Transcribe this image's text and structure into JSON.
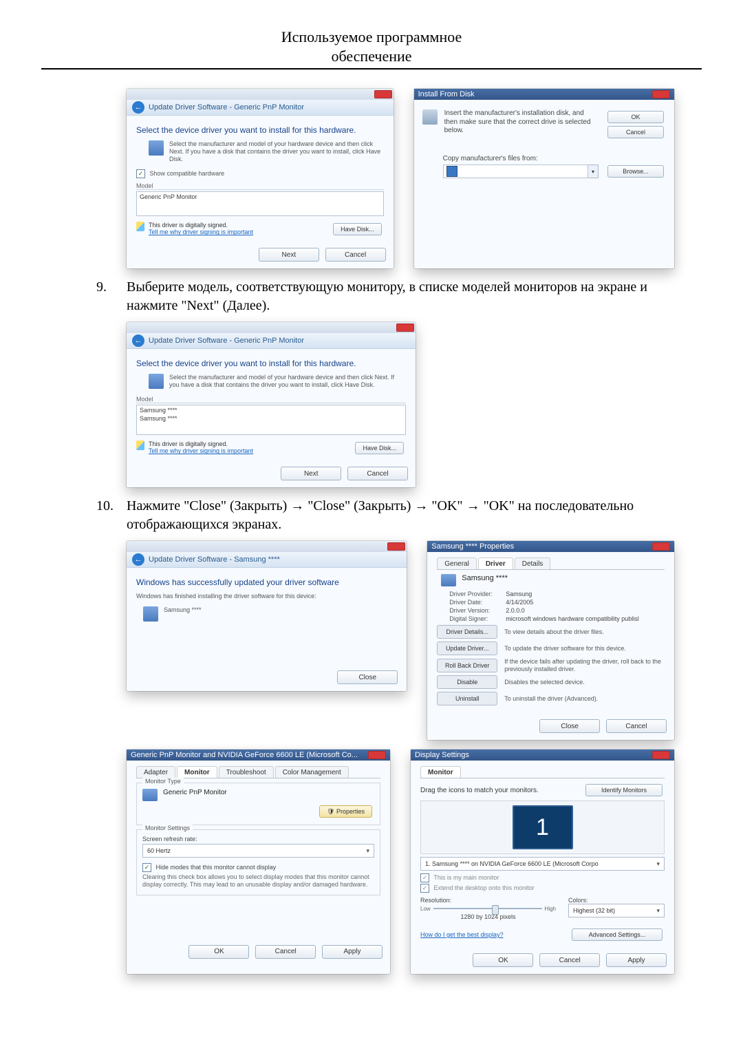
{
  "header": {
    "line1": "Используемое программное",
    "line2": "обеспечение"
  },
  "arrow": "→",
  "step9": {
    "num": "9.",
    "text": "Выберите модель, соответствующую монитору, в списке моделей мониторов на экране и нажмите \"Next\" (Далее)."
  },
  "step10": {
    "num": "10.",
    "text_before": "Нажмите \"Close\" (Закрыть)  ",
    "arrow1": "→",
    "seg1": "\"Close\" (Закрыть)  ",
    "seg2": "\"OK\"  ",
    "seg3": "\"OK\" на последовательно отображающихся экранах.",
    "full": "Нажмите \"Close\" (Закрыть)  →  \"Close\" (Закрыть)  →  \"OK\"  →  \"OK\" на последовательно отображающихся экранах."
  },
  "wizard": {
    "breadcrumb": "Update Driver Software - Generic PnP Monitor",
    "heading": "Select the device driver you want to install for this hardware.",
    "hint": "Select the manufacturer and model of your hardware device and then click Next. If you have a disk that contains the driver you want to install, click Have Disk.",
    "compat_label": "Show compatible hardware",
    "model_label": "Model",
    "model_item": "Generic PnP Monitor",
    "signed": "This driver is digitally signed.",
    "signed_link": "Tell me why driver signing is important",
    "have_disk": "Have Disk...",
    "next": "Next",
    "cancel": "Cancel"
  },
  "wizard_samsung": {
    "breadcrumb": "Update Driver Software - Generic PnP Monitor",
    "item1": "Samsung ****",
    "item2": "Samsung ****"
  },
  "install_from_disk": {
    "title": "Install From Disk",
    "instruction": "Insert the manufacturer's installation disk, and then make sure that the correct drive is selected below.",
    "ok": "OK",
    "cancel": "Cancel",
    "copy_label": "Copy manufacturer's files from:",
    "browse": "Browse..."
  },
  "finished": {
    "breadcrumb": "Update Driver Software - Samsung ****",
    "line1": "Windows has successfully updated your driver software",
    "line2": "Windows has finished installing the driver software for this device:",
    "device": "Samsung ****",
    "close": "Close"
  },
  "driver_props": {
    "title": "Samsung **** Properties",
    "tab_general": "General",
    "tab_driver": "Driver",
    "tab_details": "Details",
    "device": "Samsung ****",
    "provider_k": "Driver Provider:",
    "provider_v": "Samsung",
    "date_k": "Driver Date:",
    "date_v": "4/14/2005",
    "version_k": "Driver Version:",
    "version_v": "2.0.0.0",
    "signer_k": "Digital Signer:",
    "signer_v": "microsoft windows hardware compatibility publisl",
    "b1": "Driver Details...",
    "t1": "To view details about the driver files.",
    "b2": "Update Driver...",
    "t2": "To update the driver software for this device.",
    "b3": "Roll Back Driver",
    "t3": "If the device fails after updating the driver, roll back to the previously installed driver.",
    "b4": "Disable",
    "t4": "Disables the selected device.",
    "b5": "Uninstall",
    "t5": "To uninstall the driver (Advanced).",
    "close": "Close",
    "cancel": "Cancel"
  },
  "monitor_props": {
    "title": "Generic PnP Monitor and NVIDIA GeForce 6600 LE (Microsoft Co...",
    "tab_adapter": "Adapter",
    "tab_monitor": "Monitor",
    "tab_ts": "Troubleshoot",
    "tab_cm": "Color Management",
    "type_group": "Monitor Type",
    "type_value": "Generic PnP Monitor",
    "props_btn": "Properties",
    "settings_group": "Monitor Settings",
    "refresh_label": "Screen refresh rate:",
    "refresh_value": "60 Hertz",
    "hide_label": "Hide modes that this monitor cannot display",
    "hide_desc": "Clearing this check box allows you to select display modes that this monitor cannot display correctly. This may lead to an unusable display and/or damaged hardware.",
    "ok": "OK",
    "cancel": "Cancel",
    "apply": "Apply"
  },
  "display_settings": {
    "title": "Display Settings",
    "tab_monitor": "Monitor",
    "drag": "Drag the icons to match your monitors.",
    "identify": "Identify Monitors",
    "mon_num": "1",
    "combo": "1. Samsung **** on NVIDIA GeForce 6600 LE (Microsoft Corpo",
    "main_chk": "This is my main monitor",
    "ext_chk": "Extend the desktop onto this monitor",
    "res_label": "Resolution:",
    "res_lo": "Low",
    "res_hi": "High",
    "res_val": "1280 by 1024 pixels",
    "col_label": "Colors:",
    "col_val": "Highest (32 bit)",
    "help": "How do I get the best display?",
    "adv": "Advanced Settings...",
    "ok": "OK",
    "cancel": "Cancel",
    "apply": "Apply"
  }
}
